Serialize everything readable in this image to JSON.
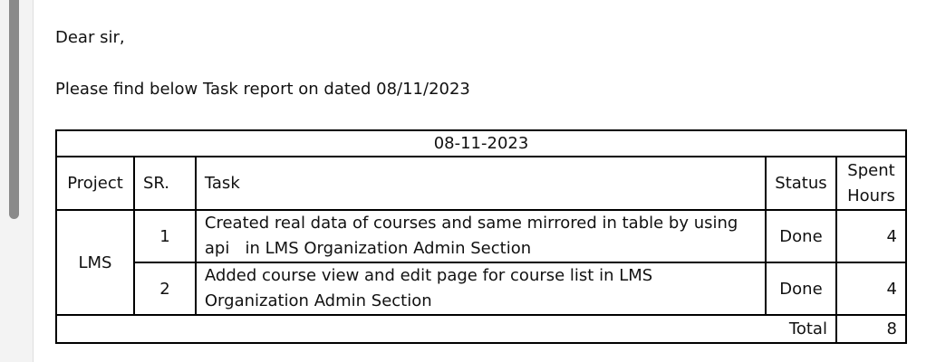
{
  "letter": {
    "greeting": "Dear sir,",
    "intro": "Please find below Task report on dated 08/11/2023"
  },
  "report": {
    "date": "08-11-2023",
    "headers": {
      "project": "Project",
      "sr": "SR.",
      "task": "Task",
      "status": "Status",
      "spent_line1": "Spent",
      "spent_line2": "Hours"
    },
    "project": "LMS",
    "rows": [
      {
        "sr": "1",
        "task": "Created real data of courses and same mirrored in table by using api   in LMS Organization Admin Section",
        "status": "Done",
        "hours": "4"
      },
      {
        "sr": "2",
        "task": "Added course view and edit page for course list in LMS Organization Admin Section",
        "status": "Done",
        "hours": "4"
      }
    ],
    "total_label": "Total",
    "total_value": "8"
  }
}
